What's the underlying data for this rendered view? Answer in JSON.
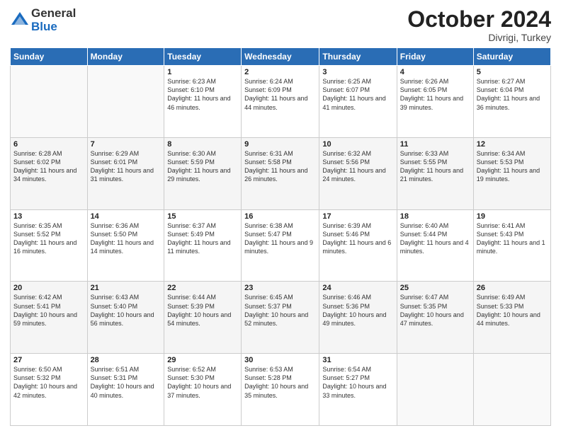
{
  "logo": {
    "general": "General",
    "blue": "Blue"
  },
  "title": "October 2024",
  "location": "Divrigi, Turkey",
  "days_of_week": [
    "Sunday",
    "Monday",
    "Tuesday",
    "Wednesday",
    "Thursday",
    "Friday",
    "Saturday"
  ],
  "weeks": [
    [
      {
        "day": "",
        "info": ""
      },
      {
        "day": "",
        "info": ""
      },
      {
        "day": "1",
        "info": "Sunrise: 6:23 AM\nSunset: 6:10 PM\nDaylight: 11 hours and 46 minutes."
      },
      {
        "day": "2",
        "info": "Sunrise: 6:24 AM\nSunset: 6:09 PM\nDaylight: 11 hours and 44 minutes."
      },
      {
        "day": "3",
        "info": "Sunrise: 6:25 AM\nSunset: 6:07 PM\nDaylight: 11 hours and 41 minutes."
      },
      {
        "day": "4",
        "info": "Sunrise: 6:26 AM\nSunset: 6:05 PM\nDaylight: 11 hours and 39 minutes."
      },
      {
        "day": "5",
        "info": "Sunrise: 6:27 AM\nSunset: 6:04 PM\nDaylight: 11 hours and 36 minutes."
      }
    ],
    [
      {
        "day": "6",
        "info": "Sunrise: 6:28 AM\nSunset: 6:02 PM\nDaylight: 11 hours and 34 minutes."
      },
      {
        "day": "7",
        "info": "Sunrise: 6:29 AM\nSunset: 6:01 PM\nDaylight: 11 hours and 31 minutes."
      },
      {
        "day": "8",
        "info": "Sunrise: 6:30 AM\nSunset: 5:59 PM\nDaylight: 11 hours and 29 minutes."
      },
      {
        "day": "9",
        "info": "Sunrise: 6:31 AM\nSunset: 5:58 PM\nDaylight: 11 hours and 26 minutes."
      },
      {
        "day": "10",
        "info": "Sunrise: 6:32 AM\nSunset: 5:56 PM\nDaylight: 11 hours and 24 minutes."
      },
      {
        "day": "11",
        "info": "Sunrise: 6:33 AM\nSunset: 5:55 PM\nDaylight: 11 hours and 21 minutes."
      },
      {
        "day": "12",
        "info": "Sunrise: 6:34 AM\nSunset: 5:53 PM\nDaylight: 11 hours and 19 minutes."
      }
    ],
    [
      {
        "day": "13",
        "info": "Sunrise: 6:35 AM\nSunset: 5:52 PM\nDaylight: 11 hours and 16 minutes."
      },
      {
        "day": "14",
        "info": "Sunrise: 6:36 AM\nSunset: 5:50 PM\nDaylight: 11 hours and 14 minutes."
      },
      {
        "day": "15",
        "info": "Sunrise: 6:37 AM\nSunset: 5:49 PM\nDaylight: 11 hours and 11 minutes."
      },
      {
        "day": "16",
        "info": "Sunrise: 6:38 AM\nSunset: 5:47 PM\nDaylight: 11 hours and 9 minutes."
      },
      {
        "day": "17",
        "info": "Sunrise: 6:39 AM\nSunset: 5:46 PM\nDaylight: 11 hours and 6 minutes."
      },
      {
        "day": "18",
        "info": "Sunrise: 6:40 AM\nSunset: 5:44 PM\nDaylight: 11 hours and 4 minutes."
      },
      {
        "day": "19",
        "info": "Sunrise: 6:41 AM\nSunset: 5:43 PM\nDaylight: 11 hours and 1 minute."
      }
    ],
    [
      {
        "day": "20",
        "info": "Sunrise: 6:42 AM\nSunset: 5:41 PM\nDaylight: 10 hours and 59 minutes."
      },
      {
        "day": "21",
        "info": "Sunrise: 6:43 AM\nSunset: 5:40 PM\nDaylight: 10 hours and 56 minutes."
      },
      {
        "day": "22",
        "info": "Sunrise: 6:44 AM\nSunset: 5:39 PM\nDaylight: 10 hours and 54 minutes."
      },
      {
        "day": "23",
        "info": "Sunrise: 6:45 AM\nSunset: 5:37 PM\nDaylight: 10 hours and 52 minutes."
      },
      {
        "day": "24",
        "info": "Sunrise: 6:46 AM\nSunset: 5:36 PM\nDaylight: 10 hours and 49 minutes."
      },
      {
        "day": "25",
        "info": "Sunrise: 6:47 AM\nSunset: 5:35 PM\nDaylight: 10 hours and 47 minutes."
      },
      {
        "day": "26",
        "info": "Sunrise: 6:49 AM\nSunset: 5:33 PM\nDaylight: 10 hours and 44 minutes."
      }
    ],
    [
      {
        "day": "27",
        "info": "Sunrise: 6:50 AM\nSunset: 5:32 PM\nDaylight: 10 hours and 42 minutes."
      },
      {
        "day": "28",
        "info": "Sunrise: 6:51 AM\nSunset: 5:31 PM\nDaylight: 10 hours and 40 minutes."
      },
      {
        "day": "29",
        "info": "Sunrise: 6:52 AM\nSunset: 5:30 PM\nDaylight: 10 hours and 37 minutes."
      },
      {
        "day": "30",
        "info": "Sunrise: 6:53 AM\nSunset: 5:28 PM\nDaylight: 10 hours and 35 minutes."
      },
      {
        "day": "31",
        "info": "Sunrise: 6:54 AM\nSunset: 5:27 PM\nDaylight: 10 hours and 33 minutes."
      },
      {
        "day": "",
        "info": ""
      },
      {
        "day": "",
        "info": ""
      }
    ]
  ]
}
